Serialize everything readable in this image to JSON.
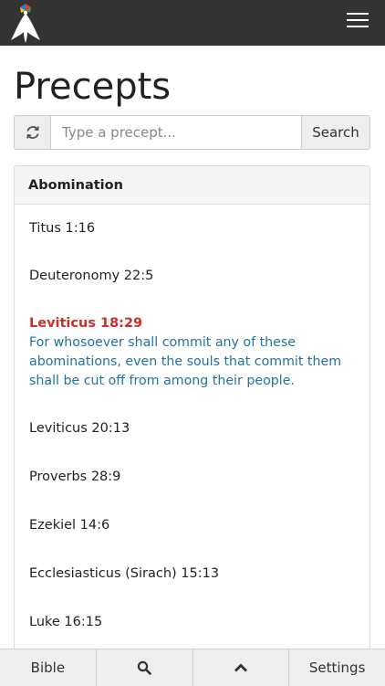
{
  "header": {
    "logo_icon": "ambassador-dove-logo",
    "menu_icon": "hamburger-icon"
  },
  "page": {
    "title": "Precepts"
  },
  "search": {
    "refresh_icon": "refresh-icon",
    "placeholder": "Type a precept...",
    "value": "",
    "button_label": "Search"
  },
  "panel": {
    "heading": "Abomination",
    "items": [
      {
        "ref": "Titus 1:16",
        "active": false
      },
      {
        "ref": "Deuteronomy 22:5",
        "active": false
      },
      {
        "ref": "Leviticus 18:29",
        "active": true,
        "verse": "For whosoever shall commit any of these abominations, even the souls that commit them shall be cut off from among their people."
      },
      {
        "ref": "Leviticus 20:13",
        "active": false
      },
      {
        "ref": "Proverbs 28:9",
        "active": false
      },
      {
        "ref": "Ezekiel 14:6",
        "active": false
      },
      {
        "ref": "Ecclesiasticus (Sirach) 15:13",
        "active": false
      },
      {
        "ref": "Luke 16:15",
        "active": false
      }
    ]
  },
  "bottom_nav": {
    "bible_label": "Bible",
    "search_icon": "search-icon",
    "up_icon": "chevron-up-icon",
    "settings_label": "Settings"
  },
  "colors": {
    "topbar": "#333333",
    "active_ref": "#c9302c",
    "verse_text": "#23739e"
  }
}
